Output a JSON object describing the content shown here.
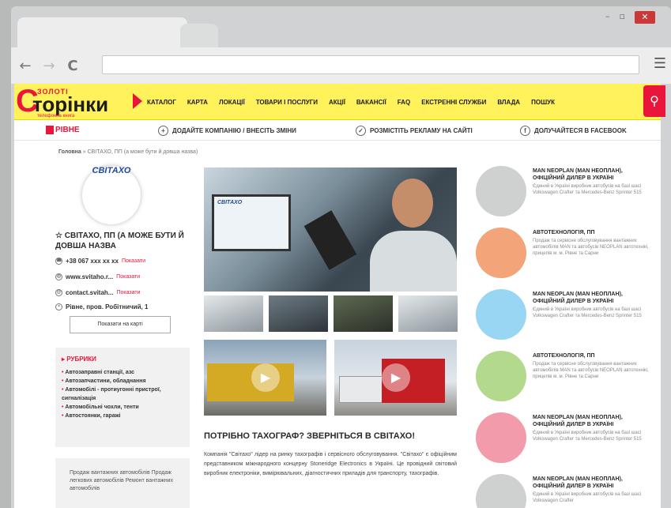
{
  "browser": {
    "nav_back": "←",
    "nav_forward": "→",
    "nav_reload": "C",
    "menu_icon": "☰",
    "window_min": "–",
    "window_max": "▫",
    "window_close": "✕"
  },
  "site": {
    "logo_top": "ЗОЛОТІ",
    "logo_letter": "С",
    "logo_main": "торінки",
    "logo_tagline": "телефонна книга",
    "nav": [
      "КАТАЛОГ",
      "КАРТА",
      "ЛОКАЦІЇ",
      "ТОВАРИ І ПОСЛУГИ",
      "АКЦІЇ",
      "ВАКАНСІЇ",
      "FAQ",
      "ЕКСТРЕННІ СЛУЖБИ",
      "ВЛАДА",
      "ПОШУК"
    ],
    "search_icon": "⚲",
    "city": "РІВНЕ",
    "sub_actions": [
      {
        "icon": "+",
        "label": "ДОДАЙТЕ КОМПАНІЮ / ВНЕСІТЬ ЗМІНИ"
      },
      {
        "icon": "✓",
        "label": "РОЗМІСТІТЬ РЕКЛАМУ НА САЙТІ"
      },
      {
        "icon": "f",
        "label": "ДОЛУЧАЙТЕСЯ В FACEBOOK"
      }
    ],
    "breadcrumb_home": "Головна",
    "breadcrumb_rest": "» СВІТАХО, ПП (а може бути й довша назва)"
  },
  "company": {
    "logo_text": "СВІТАХО",
    "name": "СВІТАХО, ПП (А МОЖЕ БУТИ Й ДОВША НАЗВА",
    "phone": "+38 067 xxx xx xx",
    "site": "www.svitaho.r...",
    "email": "contact.svitah...",
    "address": "Рівне, пров. Робітничий, 1",
    "more": "Показати",
    "map_button": "Показати на карті"
  },
  "rubrics": {
    "title": "РУБРИКИ",
    "items": [
      "Автозаправні станції, азс",
      "Автозапчастини, обладнання",
      "Автомобілі - протиугонні пристрої, сигналізація",
      "Автомобільні чохли, тенти",
      "Автостоянки, гаражі"
    ]
  },
  "left_text": "Продаж вантажних автомобілів Продаж легкових автомобілів Ремонт вантажних автомобілів",
  "main": {
    "screen_logo": "СВІТАХО",
    "title": "ПОТРІБНО ТАХОГРАФ? ЗВЕРНІТЬСЯ В СВІТАХО!",
    "text": "Компанія \"Світахо\" лідер на ринку тахографів і сервісного обслуговування. \"Світахо\" є офіційним представником міжнародного концерну Stoneridge Electronics в Україні. Це провідний світовий виробник електроніки, вимірювальних, діагностичних приладів для транспорту, тахографів.",
    "play_icon": "▶"
  },
  "ads": [
    {
      "color": "#cfd0d0",
      "title": "MAN NEOPLAN (MAN НЕОПЛАН), ОФІЦІЙНИЙ ДИЛЕР В УКРАЇНІ",
      "desc": "Єдиний в Україні виробник автобусів на базі шасі Volkswagen Crafter та Mercedes-Benz Sprinter 515"
    },
    {
      "color": "#f3a579",
      "title": "АВТОТЕХНОЛОГІЯ, ПП",
      "desc": "Продаж та сервісне обслуговування вантажних автомобілів MAN та автобусів NEOPLAN автотехнікі, прицепів м. м. Рівне та Сарни"
    },
    {
      "color": "#98d6f3",
      "title": "MAN NEOPLAN (MAN НЕОПЛАН), ОФІЦІЙНИЙ ДИЛЕР В УКРАЇНІ",
      "desc": "Єдиний в Україні виробник автобусів на базі шасі Volkswagen Crafter та Mercedes-Benz Sprinter 515"
    },
    {
      "color": "#b2d98c",
      "title": "АВТОТЕХНОЛОГІЯ, ПП",
      "desc": "Продаж та сервісне обслуговування вантажних автомобілів MAN та автобусів NEOPLAN автотехнікі, прицепів м. м. Рівне та Сарни"
    },
    {
      "color": "#f19bab",
      "title": "MAN NEOPLAN (MAN НЕОПЛАН), ОФІЦІЙНИЙ ДИЛЕР В УКРАЇНІ",
      "desc": "Єдиний в Україні виробник автобусів на базі шасі Volkswagen Crafter та Mercedes-Benz Sprinter 515"
    },
    {
      "color": "#cfd0d0",
      "title": "MAN NEOPLAN (MAN НЕОПЛАН), ОФІЦІЙНИЙ ДИЛЕР В УКРАЇНІ",
      "desc": "Єдиний в Україні виробник автобусів на базі шасі Volkswagen Crafter"
    }
  ]
}
